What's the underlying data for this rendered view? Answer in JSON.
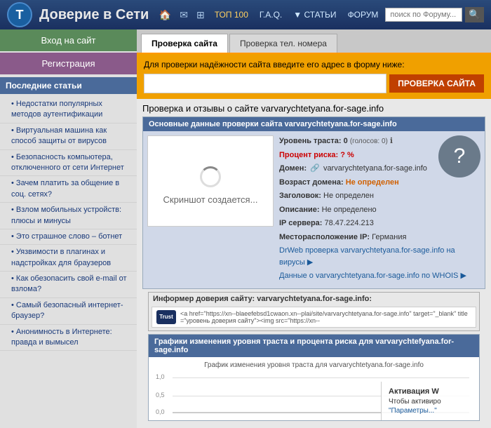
{
  "header": {
    "logo_letter": "Т",
    "logo_text": "Доверие в Сети",
    "nav": {
      "home_icon": "🏠",
      "mail_icon": "✉",
      "grid_icon": "⊞",
      "top100": "ТОП 100",
      "faq": "Г.А.Q.",
      "articles": "▼ СТАТЬИ",
      "forum": "ФОРУМ",
      "search_placeholder": "поиск по Форуму...",
      "search_btn": "🔍"
    }
  },
  "sidebar": {
    "login_btn": "Вход на сайт",
    "register_btn": "Регистрация",
    "articles_title": "Последние статьи",
    "articles": [
      "Недостатки популярных методов аутентификации",
      "Виртуальная машина как способ защиты от вирусов",
      "Безопасность компьютера, отключенного от сети Интернет",
      "Зачем платить за общение в соц. сетях?",
      "Взлом мобильных устройств: плюсы и минусы",
      "Это страшное слово – ботнет",
      "Уязвимости в плагинах и надстройках для браузеров",
      "Как обезопасить свой e-mail от взлома?",
      "Самый безопасный интернет-браузер?",
      "Анонимность в Интернете: правда и вымысел"
    ]
  },
  "main": {
    "tabs": [
      {
        "label": "Проверка сайта",
        "active": true
      },
      {
        "label": "Проверка тел. номера",
        "active": false
      }
    ],
    "check_form": {
      "label": "Для проверки надёжности сайта введите его адрес в форму ниже:",
      "placeholder": "",
      "btn_label": "ПРОВЕРКА САЙТА"
    },
    "results_title": "Проверка и отзывы о сайте varvarychtetyana.for-sage.info",
    "data_box": {
      "header": "Основные данные проверки сайта varvarychtetyana.for-sage.info",
      "screenshot_label": "Скриншот создается...",
      "trust_level": "Уровень траста: 0",
      "trust_votes": "(голосов: 0)",
      "trust_percent_label": "Процент риска: ? %",
      "domain_label": "Домен:",
      "domain_icon": "🔗",
      "domain_value": "varvarychtetyana.for-sage.info",
      "age_label": "Возраст домена:",
      "age_value": "Не определен",
      "header_label": "Заголовок:",
      "header_value": "Не определен",
      "desc_label": "Описание:",
      "desc_value": "Не определено",
      "ip_label": "IP сервера:",
      "ip_value": "78.47.224.213",
      "location_label": "Месторасположение IP:",
      "location_value": "Германия",
      "drweb_link": "DrWeb проверка varvarychtetyana.for-sage.info на вирусы ▶",
      "whois_link": "Данные о varvarychtetyana.for-sage.info по WHOIS ▶"
    },
    "informer": {
      "label": "Информер доверия сайту: varvarychtetyana.for-sage.info:",
      "mini_logo": "Trust",
      "code": "<a href=\"https://xn--blaeefebsd1cwaon.xn--plai/site/varvarychtetyana.for-sage.info\" target=\"_blank\" title=\"уровень доверия сайту\"><img src=\"https://xn--"
    },
    "graph": {
      "header": "Графики изменения уровня траста и процента риска для varvarychtefyana.for-sage.info",
      "title": "График изменения уровня траста для varvarychtetyana.for-sage.info",
      "y_labels": [
        "1,0",
        "0,5",
        "0,0"
      ],
      "activation_title": "Активация W",
      "activation_text": "Чтобы активиро",
      "activation_link": "\"Параметры...\""
    }
  }
}
